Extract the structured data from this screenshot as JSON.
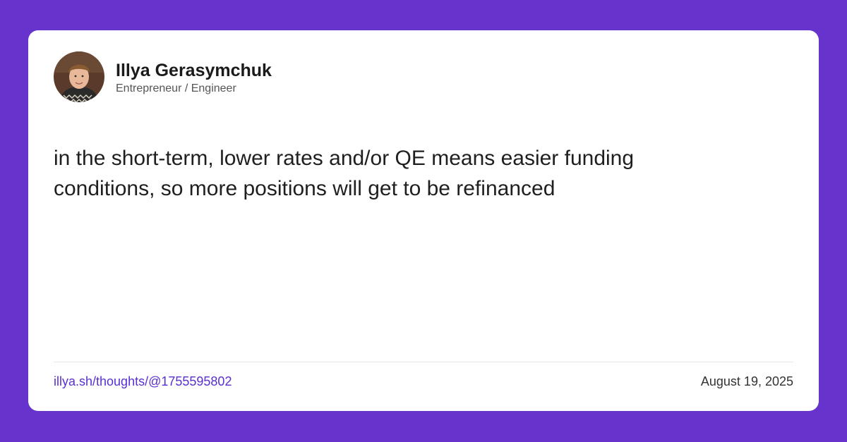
{
  "author": {
    "name": "Illya Gerasymchuk",
    "role": "Entrepreneur / Engineer",
    "avatar_icon": "avatar-photo-icon"
  },
  "post": {
    "text": "in the short-term, lower rates and/or QE means easier funding conditions, so more positions will get to be refinanced"
  },
  "footer": {
    "link": "illya.sh/thoughts/@1755595802",
    "date": "August 19, 2025"
  },
  "colors": {
    "background": "#6633cc",
    "card": "#ffffff",
    "link": "#5a2fd0"
  }
}
